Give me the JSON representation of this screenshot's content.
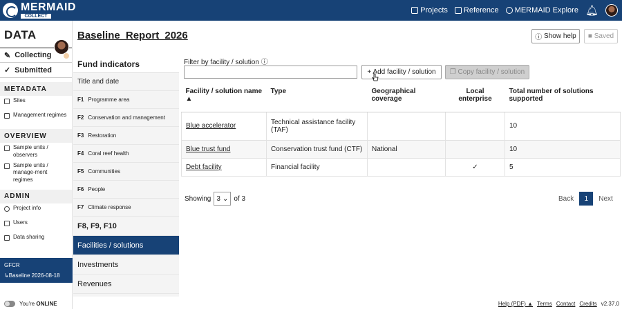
{
  "topbar": {
    "logo_main": "MERMAID",
    "logo_sub": "COLLECT",
    "nav": [
      "Projects",
      "Reference",
      "MERMAID Explore"
    ]
  },
  "sidebar": {
    "brand": "DATA",
    "collecting": "Collecting",
    "submitted": "Submitted",
    "metadata_label": "METADATA",
    "metadata": [
      "Sites",
      "Management regimes"
    ],
    "overview_label": "OVERVIEW",
    "overview": [
      "Sample units / observers",
      "Sample units / manage-ment regimes"
    ],
    "admin_label": "ADMIN",
    "admin": [
      "Project info",
      "Users",
      "Data sharing"
    ],
    "gfcr": "GFCR",
    "baseline": "↳Baseline 2026-08-18",
    "online_prefix": "You're",
    "online_status": "ONLINE"
  },
  "header": {
    "title": "Baseline Report 2026",
    "show_help": "Show help",
    "saved": "Saved"
  },
  "fundnav": {
    "heading": "Fund indicators",
    "title_date": "Title and date",
    "items": [
      {
        "code": "F1",
        "label": "Programme area"
      },
      {
        "code": "F2",
        "label": "Conservation and management"
      },
      {
        "code": "F3",
        "label": "Restoration"
      },
      {
        "code": "F4",
        "label": "Coral reef health"
      },
      {
        "code": "F5",
        "label": "Communities"
      },
      {
        "code": "F6",
        "label": "People"
      },
      {
        "code": "F7",
        "label": "Climate response"
      }
    ],
    "f8": "F8, F9, F10",
    "facilities": "Facilities / solutions",
    "investments": "Investments",
    "revenues": "Revenues"
  },
  "filter": {
    "label": "Filter by facility / solution",
    "value": "",
    "add": "+ Add facility / solution",
    "copy": "Copy facility / solution"
  },
  "table": {
    "headers": [
      "Facility / solution name ▲",
      "Type",
      "Geographical coverage",
      "Local enterprise",
      "Total number of solutions supported"
    ],
    "rows": [
      {
        "name": "Blue accelerator",
        "type": "Technical assistance facility (TAF)",
        "geo": "",
        "local": "",
        "total": "10"
      },
      {
        "name": "Blue trust fund",
        "type": "Conservation trust fund (CTF)",
        "geo": "National",
        "local": "",
        "total": "10"
      },
      {
        "name": "Debt facility",
        "type": "Financial facility",
        "geo": "",
        "local": "✓",
        "total": "5"
      }
    ]
  },
  "pagination": {
    "showing": "Showing",
    "page_size": "3",
    "of": "of 3",
    "back": "Back",
    "page": "1",
    "next": "Next"
  },
  "footer": {
    "help": "Help (PDF) ▲",
    "terms": "Terms",
    "contact": "Contact",
    "credits": "Credits",
    "version": "v2.37.0"
  }
}
